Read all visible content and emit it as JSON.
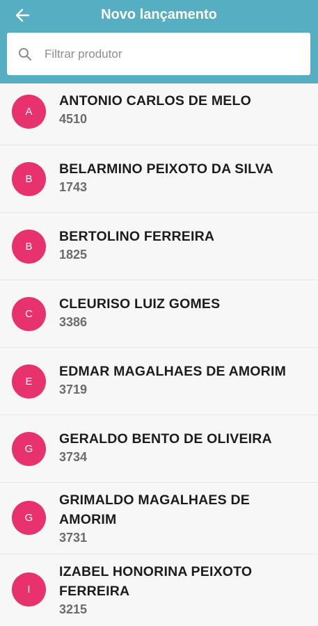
{
  "header": {
    "title": "Novo lançamento",
    "back_icon": "arrow-left-icon",
    "background_color": "#56aec2"
  },
  "search": {
    "placeholder": "Filtrar produtor",
    "value": "",
    "icon": "search-icon"
  },
  "avatar_color": "#e8326e",
  "producers": [
    {
      "initial": "A",
      "name": "ANTONIO CARLOS DE MELO",
      "code": "4510"
    },
    {
      "initial": "B",
      "name": "BELARMINO PEIXOTO DA SILVA",
      "code": "1743"
    },
    {
      "initial": "B",
      "name": "BERTOLINO FERREIRA",
      "code": "1825"
    },
    {
      "initial": "C",
      "name": "CLEURISO LUIZ GOMES",
      "code": "3386"
    },
    {
      "initial": "E",
      "name": "EDMAR MAGALHAES DE AMORIM",
      "code": "3719"
    },
    {
      "initial": "G",
      "name": "GERALDO BENTO DE OLIVEIRA",
      "code": "3734"
    },
    {
      "initial": "G",
      "name": "GRIMALDO MAGALHAES DE AMORIM",
      "code": "3731"
    },
    {
      "initial": "I",
      "name": "IZABEL HONORINA PEIXOTO FERREIRA",
      "code": "3215"
    }
  ]
}
